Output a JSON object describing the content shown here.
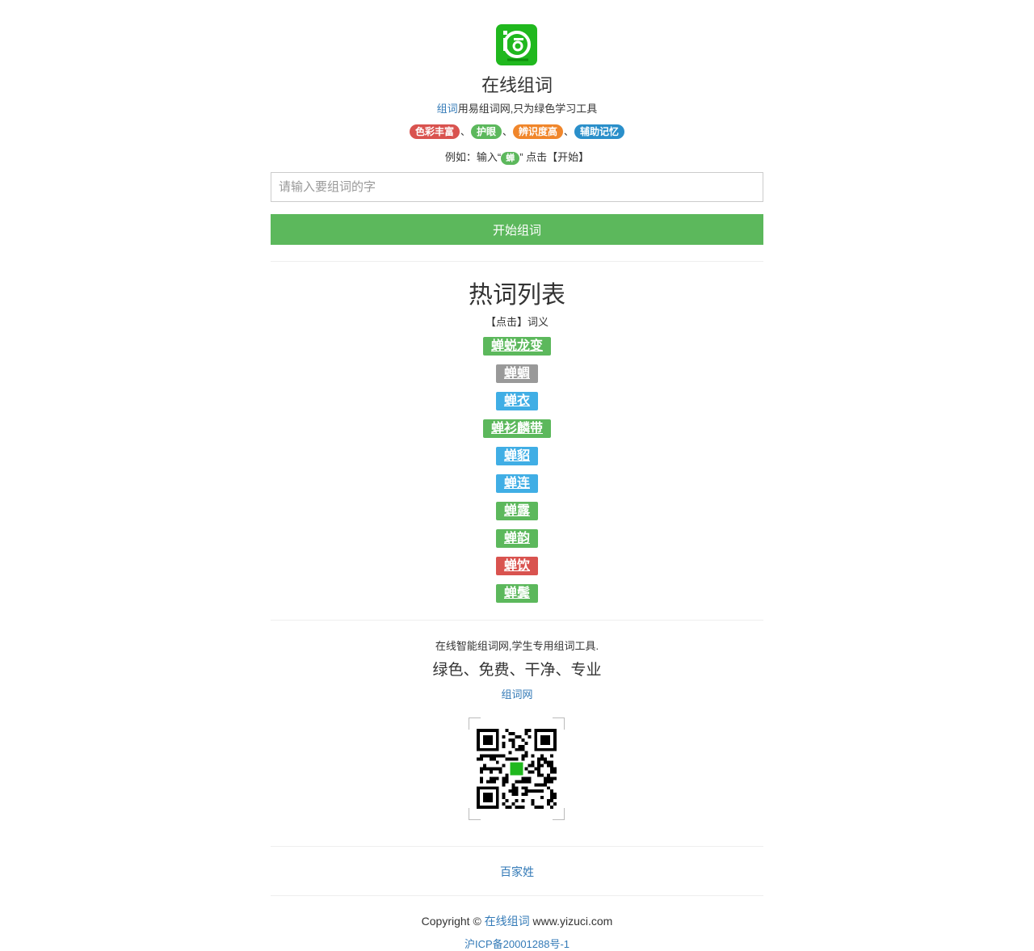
{
  "header": {
    "logo_icon": "green-word-logo-icon",
    "title": "在线组词",
    "subtitle_link": "组词",
    "subtitle_rest": "用易组词网,只为绿色学习工具",
    "tags": [
      {
        "label": "色彩丰富",
        "color": "#d9534f"
      },
      {
        "label": "护眼",
        "color": "#5cb85c"
      },
      {
        "label": "辨识度高",
        "color": "#f0862b"
      },
      {
        "label": "辅助记忆",
        "color": "#2a8fca"
      }
    ],
    "tag_separator": "、",
    "example_prefix": "例如：输入“",
    "example_char": "蝉",
    "example_suffix": "” 点击【开始】"
  },
  "search": {
    "placeholder": "请输入要组词的字",
    "value": "",
    "button_label": "开始组词"
  },
  "hot": {
    "title": "热词列表",
    "note": "【点击】词义",
    "words": [
      {
        "label": "蝉蜕龙变",
        "color": "#5cb85c"
      },
      {
        "label": "蝉蜩",
        "color": "#999999"
      },
      {
        "label": "蝉衣",
        "color": "#40aee5"
      },
      {
        "label": "蝉衫麟带",
        "color": "#5cb85c"
      },
      {
        "label": "蝉貂",
        "color": "#40aee5"
      },
      {
        "label": "蝉连",
        "color": "#40aee5"
      },
      {
        "label": "蝉露",
        "color": "#5cb85c"
      },
      {
        "label": "蝉韵",
        "color": "#5cb85c"
      },
      {
        "label": "蝉饮",
        "color": "#d9534f"
      },
      {
        "label": "蝉鬓",
        "color": "#5cb85c"
      }
    ]
  },
  "footer": {
    "line1": "在线智能组词网,学生专用组词工具.",
    "line2": "绿色、免费、干净、专业",
    "site_link": "组词网",
    "qr_icon": "qr-code-icon",
    "baijiaxing_link": "百家姓",
    "copyright_prefix": "Copyright © ",
    "copyright_link": "在线组词",
    "copyright_suffix": " www.yizuci.com",
    "icp": "沪ICP备20001288号-1"
  }
}
